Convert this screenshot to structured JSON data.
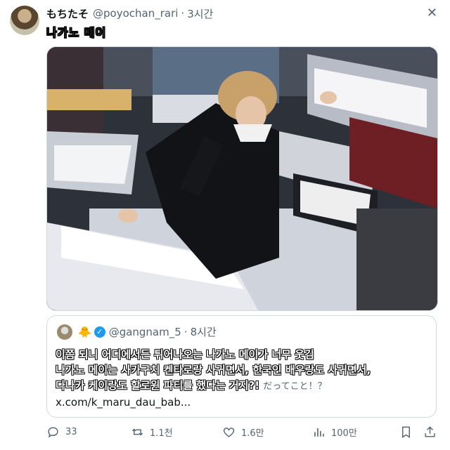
{
  "author": {
    "name": "もちたそ",
    "handle": "@poyochan_rari",
    "time": "3시간"
  },
  "tweet": {
    "text": "나가노 메이"
  },
  "quote": {
    "emoji": "🐥",
    "handle": "@gangnam_5",
    "time": "8시간",
    "lines": [
      "이쯤 되니 어디에서든 튀어나오는 나가노 메이가 너무 웃김",
      "나가노 메이는 사카구치 켄타로랑 사귀면서, 한국인 배우랑도 사귀면서,",
      "다나카 케이랑도 할로윈 파티를 했다는 거지?!"
    ],
    "overlay_text": "だってこと！？",
    "link": "x.com/k_maru_dau_bab..."
  },
  "actions": {
    "replies": "33",
    "retweets": "1.1천",
    "likes": "1.6만",
    "views": "100만"
  },
  "icons": {
    "close": "close-icon",
    "verified": "verified-badge-icon"
  },
  "colors": {
    "accent": "#1d9bf0",
    "muted": "#536471"
  }
}
